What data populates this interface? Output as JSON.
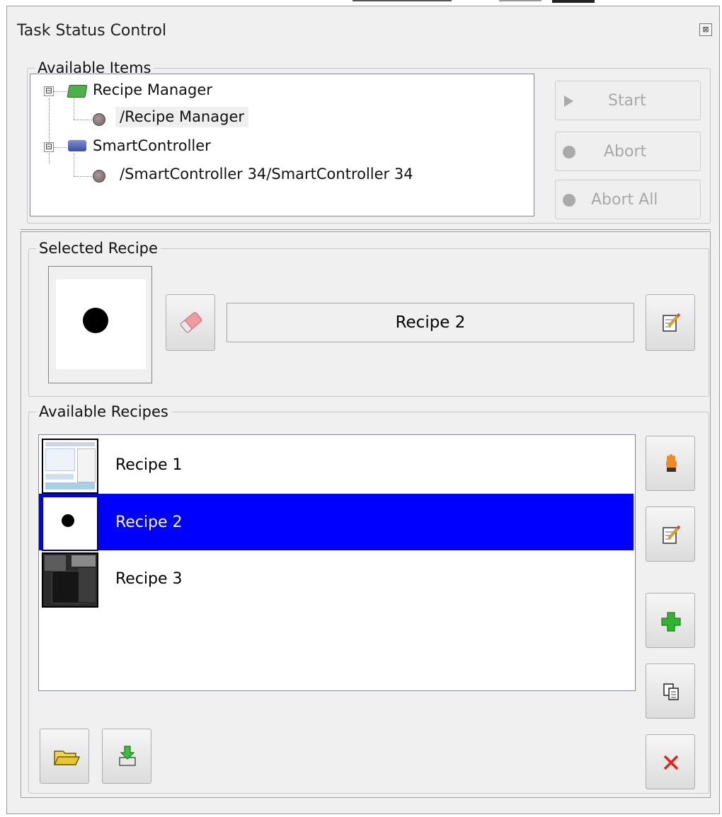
{
  "window": {
    "title": "Task Status Control",
    "close_glyph": "⊠"
  },
  "available_items": {
    "legend": "Available Items",
    "tree": [
      {
        "label": "Recipe Manager",
        "icon": "recipe-manager-icon",
        "expander": "⊟",
        "children": [
          {
            "label": "/Recipe Manager",
            "icon": "gear-icon"
          }
        ]
      },
      {
        "label": "SmartController",
        "icon": "controller-icon",
        "expander": "⊟",
        "children": [
          {
            "label": "/SmartController 34/SmartController 34",
            "icon": "gear-icon"
          }
        ]
      }
    ],
    "buttons": {
      "start": "Start",
      "abort": "Abort",
      "abort_all": "Abort All"
    }
  },
  "selected_recipe": {
    "legend": "Selected Recipe",
    "name": "Recipe 2",
    "clear_icon": "eraser-icon",
    "edit_icon": "edit-icon"
  },
  "available_recipes": {
    "legend": "Available Recipes",
    "items": [
      {
        "label": "Recipe 1",
        "thumbnail": "screenshot-thumbnail"
      },
      {
        "label": "Recipe 2",
        "thumbnail": "dot-thumbnail",
        "selected": true
      },
      {
        "label": "Recipe 3",
        "thumbnail": "camera-thumbnail"
      }
    ],
    "side_buttons": [
      "select-hand-icon",
      "edit-icon",
      "add-icon",
      "copy-icon",
      "delete-icon"
    ],
    "bottom_buttons": [
      "open-folder-icon",
      "save-icon"
    ]
  },
  "colors": {
    "selection": "#0000ff",
    "window_bg": "#f0f0f0",
    "add": "#2fb52f",
    "delete": "#e0251b"
  }
}
